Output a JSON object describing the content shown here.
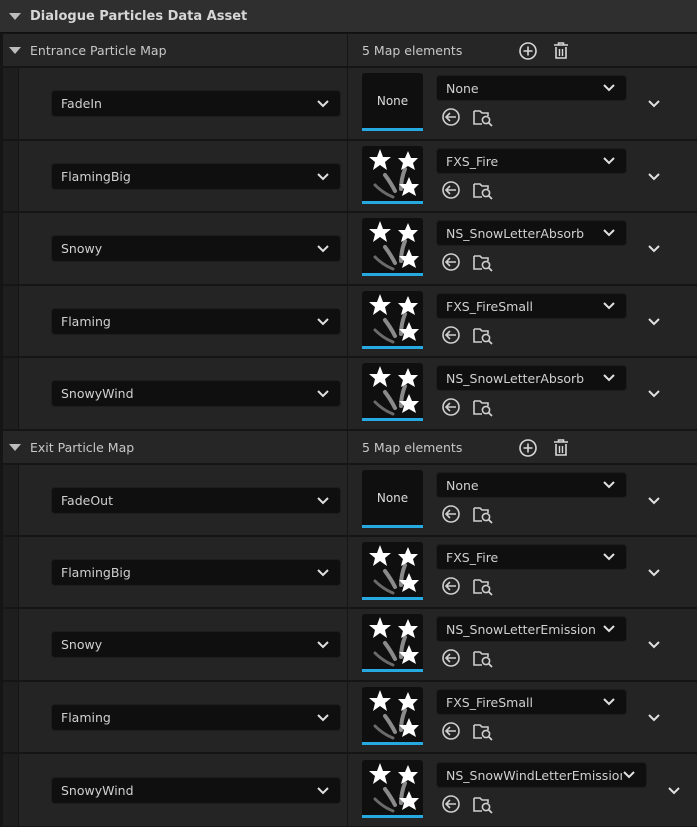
{
  "category": {
    "title": "Dialogue Particles Data Asset"
  },
  "colors": {
    "accent_bar": "#26a8e0",
    "background": "#151515",
    "row": "#242424",
    "combo": "#0f0f0f"
  },
  "icons": {
    "add": "add-element-icon",
    "remove": "trash-icon",
    "use_selected": "use-selected-asset-icon",
    "browse": "browse-asset-icon",
    "expand": "chevron-down-icon",
    "thumbnail": "niagara-stars-icon"
  },
  "entrance_map": {
    "title": "Entrance Particle Map",
    "count": "5 Map elements",
    "entries": [
      {
        "key": "FadeIn",
        "asset": "None",
        "thumb_text": "None"
      },
      {
        "key": "FlamingBig",
        "asset": "FXS_Fire",
        "thumb_text": ""
      },
      {
        "key": "Snowy",
        "asset": "NS_SnowLetterAbsorb",
        "thumb_text": ""
      },
      {
        "key": "Flaming",
        "asset": "FXS_FireSmall",
        "thumb_text": ""
      },
      {
        "key": "SnowyWind",
        "asset": "NS_SnowLetterAbsorb",
        "thumb_text": ""
      }
    ]
  },
  "exit_map": {
    "title": "Exit Particle Map",
    "count": "5 Map elements",
    "entries": [
      {
        "key": "FadeOut",
        "asset": "None",
        "thumb_text": "None"
      },
      {
        "key": "FlamingBig",
        "asset": "FXS_Fire",
        "thumb_text": ""
      },
      {
        "key": "Snowy",
        "asset": "NS_SnowLetterEmission",
        "thumb_text": ""
      },
      {
        "key": "Flaming",
        "asset": "FXS_FireSmall",
        "thumb_text": ""
      },
      {
        "key": "SnowyWind",
        "asset": "NS_SnowWindLetterEmission",
        "thumb_text": ""
      }
    ]
  }
}
